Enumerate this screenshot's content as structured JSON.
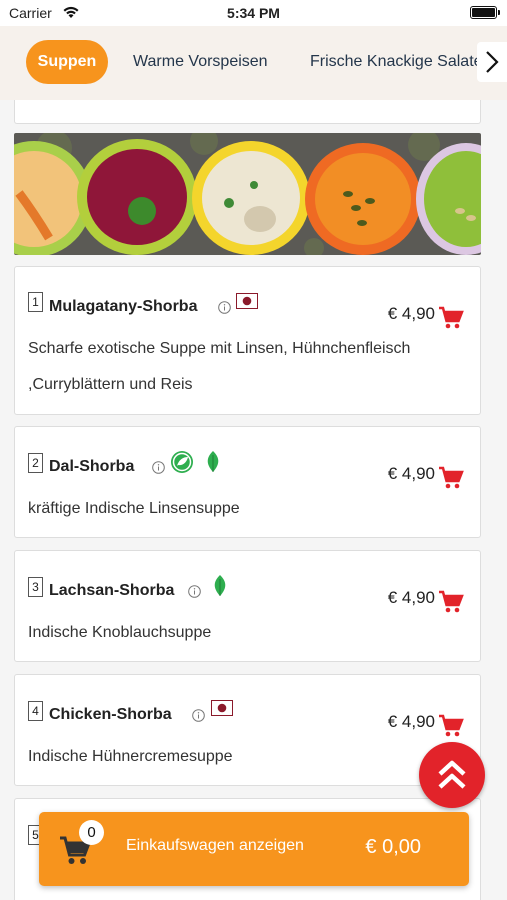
{
  "status_bar": {
    "carrier": "Carrier",
    "time": "5:34 PM"
  },
  "categories": [
    {
      "label": "Suppen",
      "active": true
    },
    {
      "label": "Warme Vorspeisen",
      "active": false
    },
    {
      "label": "Frische Knackige Salate",
      "active": false
    }
  ],
  "menu_items": [
    {
      "number": "1",
      "name": "Mulagatany-Shorba",
      "price": "€ 4,90",
      "description": "Scharfe exotische Suppe mit Linsen, Hühnchenfleisch ,Curryblättern und Reis",
      "badges": [
        "non-veg-icon"
      ]
    },
    {
      "number": "2",
      "name": "Dal-Shorba",
      "price": "€ 4,90",
      "description": "kräftige Indische Linsensuppe",
      "badges": [
        "vegan-icon",
        "leaf-icon"
      ]
    },
    {
      "number": "3",
      "name": "Lachsan-Shorba",
      "price": "€ 4,90",
      "description": "Indische Knoblauchsuppe",
      "badges": [
        "leaf-icon"
      ]
    },
    {
      "number": "4",
      "name": "Chicken-Shorba",
      "price": "€ 4,90",
      "description": "Indische Hühnercremesuppe",
      "badges": [
        "non-veg-icon"
      ]
    },
    {
      "number": "5",
      "name": "",
      "price": "",
      "description": "",
      "badges": []
    }
  ],
  "cart": {
    "count": "0",
    "label": "Einkaufswagen anzeigen",
    "total": "€ 0,00"
  },
  "colors": {
    "accent": "#f7941d",
    "red": "#e2232a",
    "nav_text": "#24364b",
    "non_veg": "#8b1a2b",
    "leaf": "#2eae4f"
  }
}
